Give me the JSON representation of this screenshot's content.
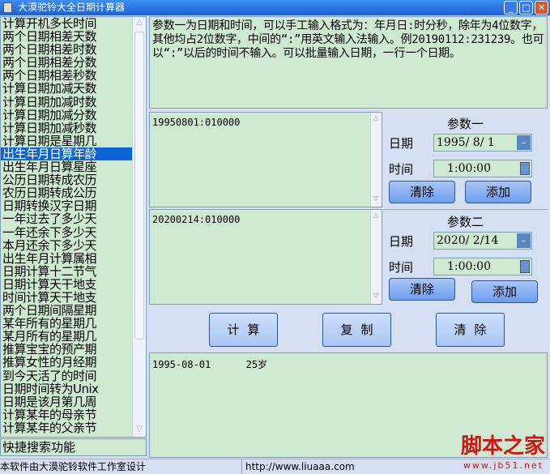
{
  "window": {
    "title": "大漠驼铃大全日期计算器",
    "min": "_",
    "max": "□",
    "close": "✕"
  },
  "sidebar": {
    "items": [
      "计算开机多长时间",
      "两个日期相差天数",
      "两个日期相差时数",
      "两个日期相差分数",
      "两个日期相差秒数",
      "计算日期加减天数",
      "计算日期加减时数",
      "计算日期加减分数",
      "计算日期加减秒数",
      "计算日期是星期几",
      "出生年月日算年龄",
      "出生年月日算星座",
      "公历日期转成农历",
      "农历日期转成公历",
      "日期转换汉字日期",
      "一年过去了多少天",
      "一年还余下多少天",
      "本月还余下多少天",
      "出生年月计算属相",
      "日期计算十二节气",
      "日期计算天干地支",
      "时间计算天干地支",
      "两个日期间隔星期",
      "某年所有的星期几",
      "某月所有的星期几",
      "推算宝宝的预产期",
      "推算女性的月经期",
      "到今天活了的时间",
      "日期时间转为Unix",
      "日期是该月第几周",
      "计算某年的母亲节",
      "计算某年的父亲节"
    ],
    "selected_index": 10,
    "search": "快捷搜索功能"
  },
  "description": "参数一为日期和时间，可以手工输入格式为：年月日:时分秒，除年为4位数字，其他均占2位数字，中间的“:”用英文输入法输入。例20190112:231239。也可以“:”以后的时间不输入。可以批量输入日期，一行一个日期。",
  "param1": {
    "text": "19950801:010000",
    "title": "参数一",
    "date_label": "日期",
    "date": "1995/ 8/ 1",
    "time_label": "时间",
    "time": "1:00:00",
    "clear": "清除",
    "add": "添加"
  },
  "param2": {
    "text": "20200214:010000",
    "title": "参数二",
    "date_label": "日期",
    "date": "2020/ 2/14",
    "time_label": "时间",
    "time": "1:00:00",
    "clear": "清除",
    "add": "添加"
  },
  "actions": {
    "calc": "计算",
    "copy": "复制",
    "clear": "清除"
  },
  "result": "1995-08-01      25岁",
  "status": {
    "left": "本软件由大漠驼铃软件工作室设计",
    "url": "http://www.liuaaa.com"
  },
  "watermark": {
    "text": "脚本之家",
    "url": "www.jb51.net"
  }
}
